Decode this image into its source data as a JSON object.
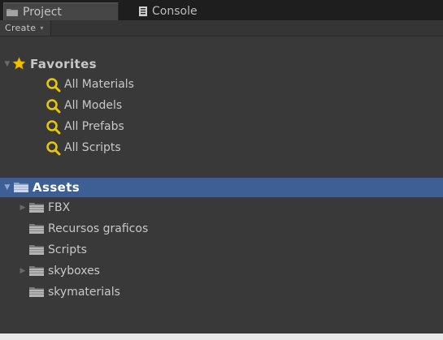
{
  "tabs": {
    "project_label": "Project",
    "console_label": "Console"
  },
  "toolbar": {
    "create_label": "Create",
    "create_arrow": "▾"
  },
  "favorites": {
    "label": "Favorites",
    "items": [
      {
        "label": "All Materials"
      },
      {
        "label": "All Models"
      },
      {
        "label": "All Prefabs"
      },
      {
        "label": "All Scripts"
      }
    ]
  },
  "assets": {
    "label": "Assets",
    "selected": true,
    "folders": [
      {
        "label": "FBX",
        "expandable": true
      },
      {
        "label": "Recursos graficos",
        "expandable": false
      },
      {
        "label": "Scripts",
        "expandable": false
      },
      {
        "label": "skyboxes",
        "expandable": true
      },
      {
        "label": "skymaterials",
        "expandable": false
      }
    ]
  },
  "icons": {
    "project_tab": "folder-icon",
    "console_tab": "console-icon",
    "favorites": "star-icon",
    "search": "search-icon",
    "folder": "folder-icon"
  },
  "colors": {
    "panel_bg": "#393939",
    "tab_bar_bg": "#1e1e1e",
    "selection": "#3e5f96",
    "star": "#f2c200",
    "search_icon": "#e8c800",
    "text": "#c8c8c8"
  }
}
